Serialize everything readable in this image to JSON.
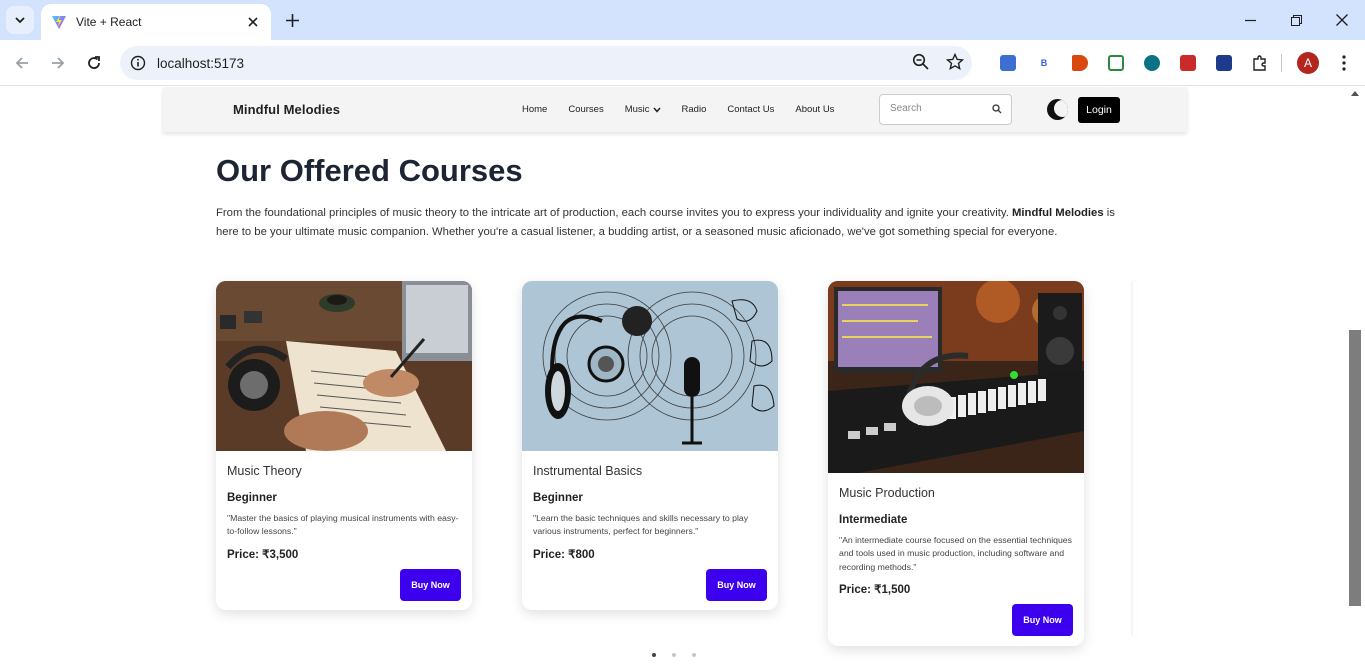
{
  "browser": {
    "tab_title": "Vite + React",
    "url": "localhost:5173",
    "profile_initial": "A",
    "extensions": [
      {
        "name": "screen-ext-icon",
        "color": "#3b6fd1"
      },
      {
        "name": "b-ext-icon",
        "color": "#3b5bdb"
      },
      {
        "name": "megaphone-ext-icon",
        "color": "#d9480f"
      },
      {
        "name": "checklist-ext-icon",
        "color": "#2b8a3e"
      },
      {
        "name": "location-ext-icon",
        "color": "#0b7285"
      },
      {
        "name": "grid-ext-icon",
        "color": "#c92a2a"
      },
      {
        "name": "window-ext-icon",
        "color": "#1e3a8a"
      },
      {
        "name": "puzzle-ext-icon",
        "color": "#444444"
      }
    ]
  },
  "site": {
    "brand": "Mindful Melodies",
    "nav": [
      "Home",
      "Courses",
      "Music",
      "Radio",
      "Contact Us",
      "About Us"
    ],
    "search_placeholder": "Search",
    "login_label": "Login"
  },
  "section": {
    "heading": "Our Offered Courses",
    "intro_before": "From the foundational principles of music theory to the intricate art of production, each course invites you to express your individuality and ignite your creativity. ",
    "intro_bold": "Mindful Melodies",
    "intro_after": " is here to be your ultimate music companion. Whether you're a casual listener, a budding artist, or a seasoned music aficionado, we've got something special for everyone."
  },
  "courses": [
    {
      "title": "Music Theory",
      "level": "Beginner",
      "description": "\"Master the basics of playing musical instruments with easy-to-follow lessons.\"",
      "price": "Price: ₹3,500",
      "buy_label": "Buy Now"
    },
    {
      "title": "Instrumental Basics",
      "level": "Beginner",
      "description": "\"Learn the basic techniques and skills necessary to play various instruments, perfect for beginners.\"",
      "price": "Price: ₹800",
      "buy_label": "Buy Now"
    },
    {
      "title": "Music Production",
      "level": "Intermediate",
      "description": "\"An intermediate course focused on the essential techniques and tools used in music production, including software and recording methods.\"",
      "price": "Price: ₹1,500",
      "buy_label": "Buy Now"
    }
  ],
  "carousel": {
    "active_index": 0,
    "count": 3
  }
}
